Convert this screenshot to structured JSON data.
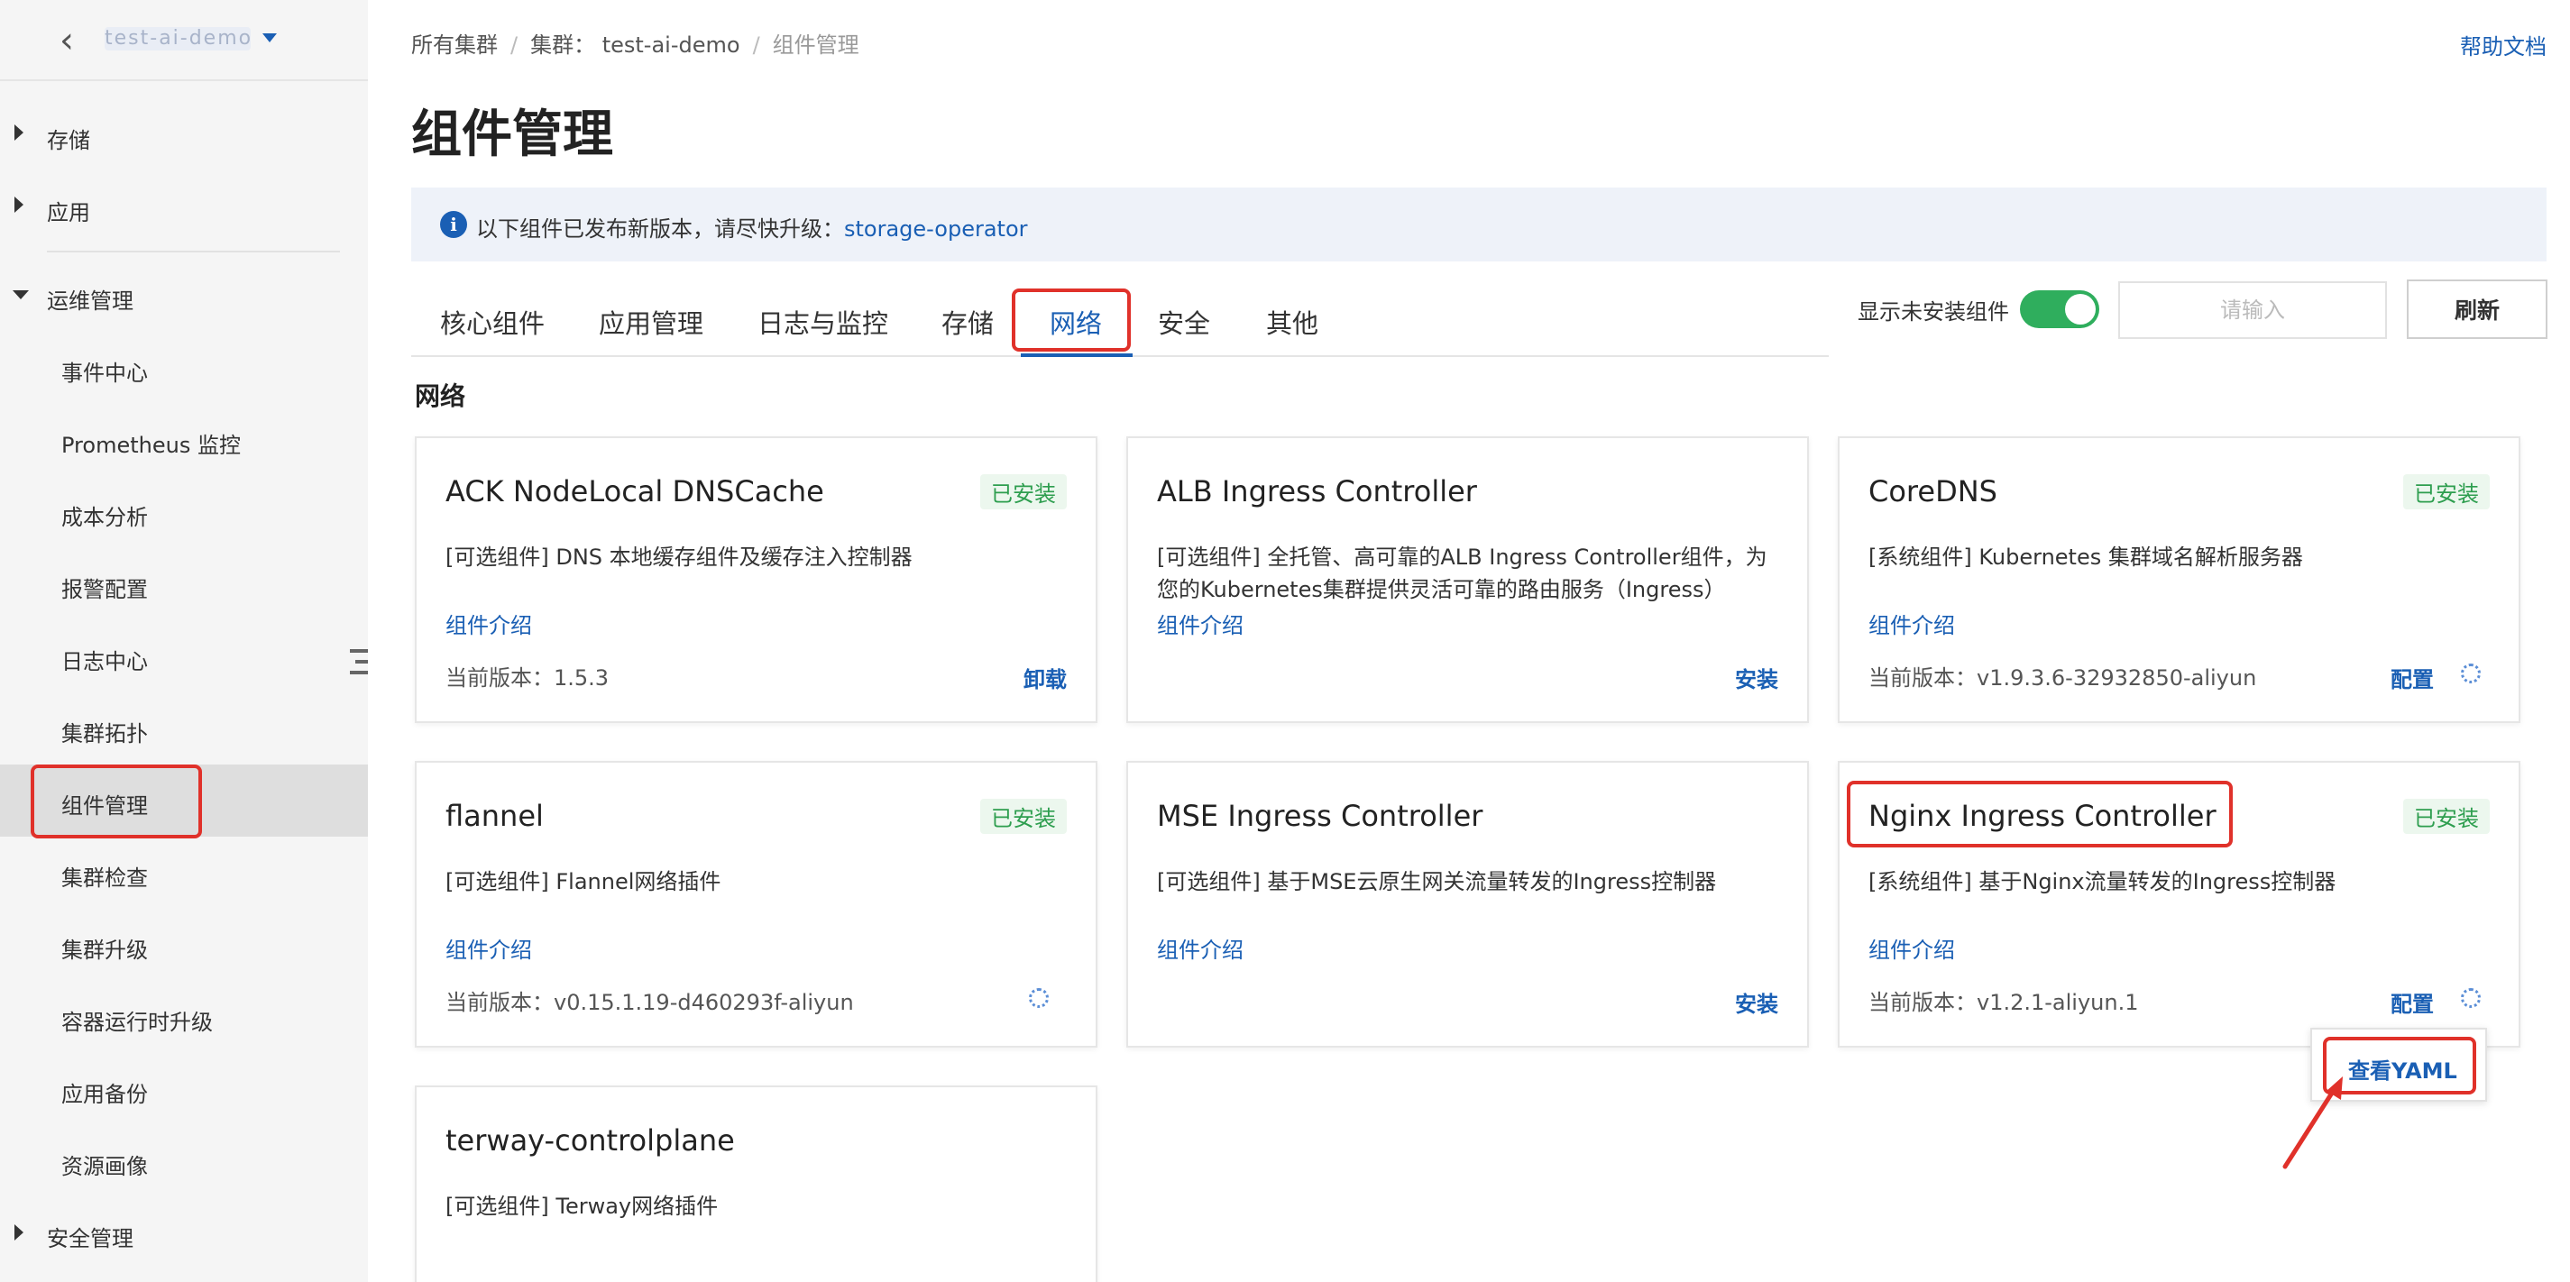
{
  "sidebar": {
    "cluster_name": "test-ai-demo",
    "items": [
      {
        "label": "存储",
        "type": "group",
        "expanded": false
      },
      {
        "label": "应用",
        "type": "group",
        "expanded": false
      },
      {
        "label": "运维管理",
        "type": "group",
        "expanded": true
      },
      {
        "label": "事件中心",
        "type": "child"
      },
      {
        "label": "Prometheus 监控",
        "type": "child"
      },
      {
        "label": "成本分析",
        "type": "child"
      },
      {
        "label": "报警配置",
        "type": "child"
      },
      {
        "label": "日志中心",
        "type": "child"
      },
      {
        "label": "集群拓扑",
        "type": "child"
      },
      {
        "label": "组件管理",
        "type": "child",
        "active": true
      },
      {
        "label": "集群检查",
        "type": "child"
      },
      {
        "label": "集群升级",
        "type": "child"
      },
      {
        "label": "容器运行时升级",
        "type": "child"
      },
      {
        "label": "应用备份",
        "type": "child"
      },
      {
        "label": "资源画像",
        "type": "child"
      },
      {
        "label": "安全管理",
        "type": "group",
        "expanded": false
      }
    ]
  },
  "breadcrumb": {
    "root": "所有集群",
    "sep": "/",
    "cluster": "集群：  test-ai-demo",
    "current": "组件管理"
  },
  "help_link": "帮助文档",
  "page_title": "组件管理",
  "notice": {
    "icon": "i",
    "text": "以下组件已发布新版本，请尽快升级：",
    "link": "storage-operator"
  },
  "tabs": [
    {
      "label": "核心组件"
    },
    {
      "label": "应用管理"
    },
    {
      "label": "日志与监控"
    },
    {
      "label": "存储"
    },
    {
      "label": "网络",
      "active": true
    },
    {
      "label": "安全"
    },
    {
      "label": "其他"
    }
  ],
  "toolbar": {
    "show_uninstalled_label": "显示未安装组件",
    "show_uninstalled_on": true,
    "search_placeholder": "请输入",
    "refresh_label": "刷新"
  },
  "section_title": "网络",
  "cards": [
    {
      "name": "ACK NodeLocal DNSCache",
      "badge": "已安装",
      "tag": "[可选组件]",
      "desc": " DNS 本地缓存组件及缓存注入控制器",
      "intro": "组件介绍",
      "version": "当前版本：1.5.3",
      "action": "卸载"
    },
    {
      "name": "ALB Ingress Controller",
      "tag": "[可选组件]",
      "desc": " 全托管、高可靠的ALB Ingress Controller组件，为您的Kubernetes集群提供灵活可靠的路由服务（Ingress）",
      "intro": "组件介绍",
      "action": "安装"
    },
    {
      "name": "CoreDNS",
      "badge": "已安装",
      "tag": "[系统组件]",
      "desc": " Kubernetes 集群域名解析服务器",
      "intro": "组件介绍",
      "version": "当前版本：v1.9.3.6-32932850-aliyun",
      "action": "配置"
    },
    {
      "name": "flannel",
      "badge": "已安装",
      "tag": "[可选组件]",
      "desc": " Flannel网络插件",
      "intro": "组件介绍",
      "version": "当前版本：v0.15.1.19-d460293f-aliyun"
    },
    {
      "name": "MSE Ingress Controller",
      "tag": "[可选组件]",
      "desc": " 基于MSE云原生网关流量转发的Ingress控制器",
      "intro": "组件介绍",
      "action": "安装"
    },
    {
      "name": "Nginx Ingress Controller",
      "badge": "已安装",
      "tag": "[系统组件]",
      "desc": " 基于Nginx流量转发的Ingress控制器",
      "intro": "组件介绍",
      "version": "当前版本：v1.2.1-aliyun.1",
      "action": "配置"
    },
    {
      "name": "terway-controlplane",
      "tag": "[可选组件]",
      "desc": " Terway网络插件"
    }
  ],
  "popover": {
    "view_yaml": "查看YAML"
  },
  "colors": {
    "accent": "#1a5fb4",
    "installed_badge_text": "#2e9e4f",
    "installed_badge_bg": "#ecf7ee",
    "toggle_on": "#2fae5d",
    "highlight": "#e0312a"
  }
}
